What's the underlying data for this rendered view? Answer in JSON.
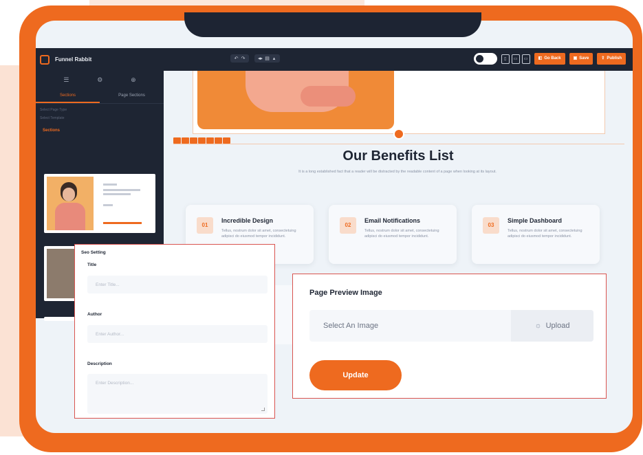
{
  "topbar": {
    "app_name": "Funnel Rabbit",
    "undo_icons": [
      "↶",
      "↷"
    ],
    "tool_icons": [
      "◂▸",
      "▤",
      "▴"
    ],
    "device_icons": [
      "▯",
      "▭",
      "▭"
    ],
    "buttons": [
      {
        "icon": "◧",
        "label": "Go Back"
      },
      {
        "icon": "▣",
        "label": "Save"
      },
      {
        "icon": "⇪",
        "label": "Publish"
      }
    ]
  },
  "sidebar": {
    "icons": [
      "☰",
      "⚙",
      "⊕"
    ],
    "tabs": [
      "Sections",
      "Page Sections"
    ],
    "rows": [
      "Select Page Type",
      "Select Template"
    ],
    "section_label": "Sections"
  },
  "canvas": {
    "benefits_title": "Our Benefits List",
    "benefits_subtitle": "It is a long established fact that a reader will be distracted by the readable content of a page when looking at its layout.",
    "cards": [
      {
        "num": "01",
        "title": "Incredible Design",
        "desc": "Tellus, nostrum dolor sit amet, consectetuing adipisci do eiusmod tempor incididunt."
      },
      {
        "num": "02",
        "title": "Email Notifications",
        "desc": "Tellus, nostrum dolor sit amet, consectetuing adipisci do eiusmod tempor incididunt."
      },
      {
        "num": "03",
        "title": "Simple Dashboard",
        "desc": "Tellus, nostrum dolor sit amet, consectetuing adipisci do eiusmod tempor incididunt."
      }
    ]
  },
  "seo": {
    "heading": "Seo Setting",
    "title_label": "Title",
    "title_placeholder": "Enter Title...",
    "author_label": "Author",
    "author_placeholder": "Enter Author...",
    "description_label": "Description",
    "description_placeholder": "Enter Description..."
  },
  "preview": {
    "heading": "Page Preview Image",
    "select_placeholder": "Select An Image",
    "upload_icon": "☼",
    "upload_label": "Upload",
    "update_label": "Update"
  },
  "colors": {
    "accent": "#ee6a1f",
    "dark": "#1e2533",
    "highlight_border": "#d9534f"
  }
}
